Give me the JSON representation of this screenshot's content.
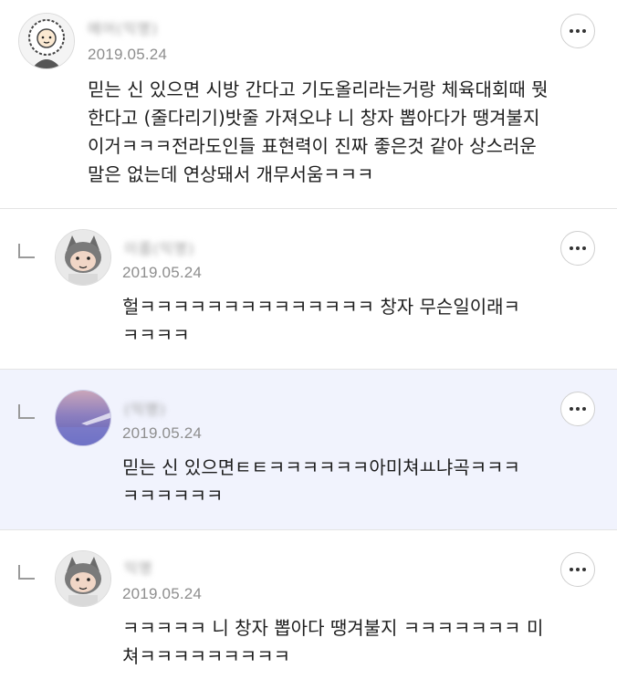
{
  "comments": [
    {
      "author": "에어(익명)",
      "date": "2019.05.24",
      "text": "믿는 신 있으면 시방 간다고 기도올리라는거랑 체육대회때 뭣\n한다고 (줄다리기)밧줄 가져오냐 니 창자 뽑아다가 땡겨불지\n이거ㅋㅋㅋ전라도인들 표현력이 진짜 좋은것 같아 상스러운\n말은 없는데 연상돼서 개무서움ㅋㅋㅋ",
      "is_reply": false,
      "highlighted": false
    },
    {
      "author": "이름(익명)",
      "date": "2019.05.24",
      "text": "헐ㅋㅋㅋㅋㅋㅋㅋㅋㅋㅋㅋㅋㅋㅋ 창자 무슨일이래ㅋ\nㅋㅋㅋㅋ",
      "is_reply": true,
      "highlighted": false
    },
    {
      "author": "(익명)",
      "date": "2019.05.24",
      "text": "믿는 신 있으면ㅌㅌㅋㅋㅋㅋㅋㅋ아미쳐ㅛ냐곡ㅋㅋㅋ\nㅋㅋㅋㅋㅋㅋ",
      "is_reply": true,
      "highlighted": true
    },
    {
      "author": "익명",
      "date": "2019.05.24",
      "text": "ㅋㅋㅋㅋㅋ 니 창자 뽑아다 땡겨불지 ㅋㅋㅋㅋㅋㅋㅋ 미\n쳐ㅋㅋㅋㅋㅋㅋㅋㅋㅋ",
      "is_reply": true,
      "highlighted": false
    }
  ],
  "icons": {
    "more": "more-horizontal-icon",
    "reply": "reply-arrow-icon"
  },
  "colors": {
    "highlight_bg": "#f1f3fd",
    "date_text": "#8e8e8e",
    "divider": "#e4e4e4"
  }
}
